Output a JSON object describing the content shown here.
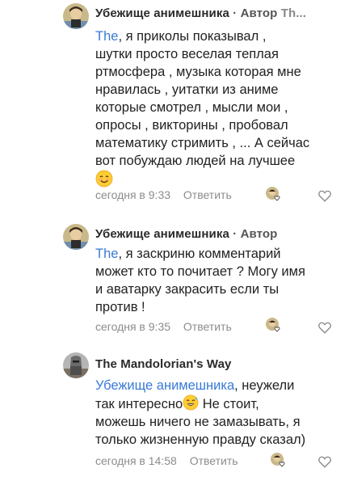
{
  "comments": [
    {
      "author": "Убежище анимешника",
      "separator": "·",
      "role": "Автор",
      "trail": "Th...",
      "mention": "The",
      "text_lines": [
        ", я приколы показывал ,",
        "шутки просто веселая теплая",
        "ртмосфера , музыка которая мне",
        "нравилась , уитатки из аниме",
        "которые смотрел , мысли мои ,",
        "опросы , викторины , пробовал",
        "математику стримить , ... А сейчас",
        "вот побуждаю людей на лучшее"
      ],
      "emoji": "smiling-face-emoji",
      "time": "сегодня в 9:33",
      "reply_label": "Ответить"
    },
    {
      "author": "Убежище анимешника",
      "separator": "·",
      "role": "Автор",
      "mention": "The",
      "text_lines": [
        ", я заскриню комментарий",
        "может кто то почитает ? Могу имя",
        "и аватарку закрасить если ты",
        "против !"
      ],
      "time": "сегодня в 9:35",
      "reply_label": "Ответить"
    },
    {
      "author": "The Mandolorian's Way",
      "mention": "Убежище анимешника",
      "line1_after_mention": ", неужели",
      "line2_before_emoji": "так интересно",
      "emoji": "sweat-smile-emoji",
      "line2_after_emoji": " Не стоит,",
      "text_lines": [
        "можешь ничего не замазывать, я",
        "только жизненную правду сказал)"
      ],
      "time": "сегодня в 14:58",
      "reply_label": "Ответить"
    }
  ],
  "colors": {
    "mention": "#3a7ad6",
    "meta": "#8c8c8c",
    "text": "#222222"
  }
}
